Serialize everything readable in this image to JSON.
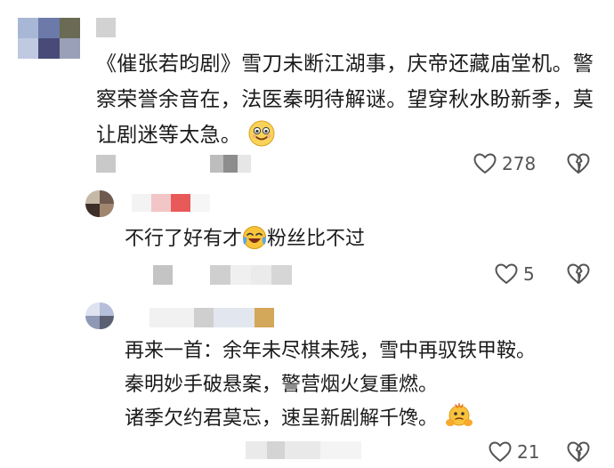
{
  "comments": [
    {
      "text_lines": [
        "《催张若昀剧》雪刀未断江湖事，庆帝还藏庙堂机。警",
        "察荣誉余音在，法医秦明待解谜。望穿秋水盼新季，莫",
        "让剧迷等太急。"
      ],
      "trailing_emoji": "smiling-face-emoji",
      "like_count": "278"
    },
    {
      "text_before_emoji": "不行了好有才",
      "emoji": "laughing-crying-emoji",
      "text_after_emoji": "粉丝比不过",
      "like_count": "5"
    },
    {
      "text_lines": [
        "再来一首：余年未尽棋未残，雪中再驭铁甲鞍。",
        "秦明妙手破悬案，警营烟火复重燃。",
        "诸季欠约君莫忘，速呈新剧解千馋。"
      ],
      "trailing_emoji": "pleading-hands-emoji",
      "like_count": "21"
    }
  ],
  "icons": {
    "like": "heart-outline-icon",
    "dislike": "broken-heart-outline-icon"
  },
  "colors": {
    "text": "#1b1b1b",
    "icon": "#555555"
  }
}
